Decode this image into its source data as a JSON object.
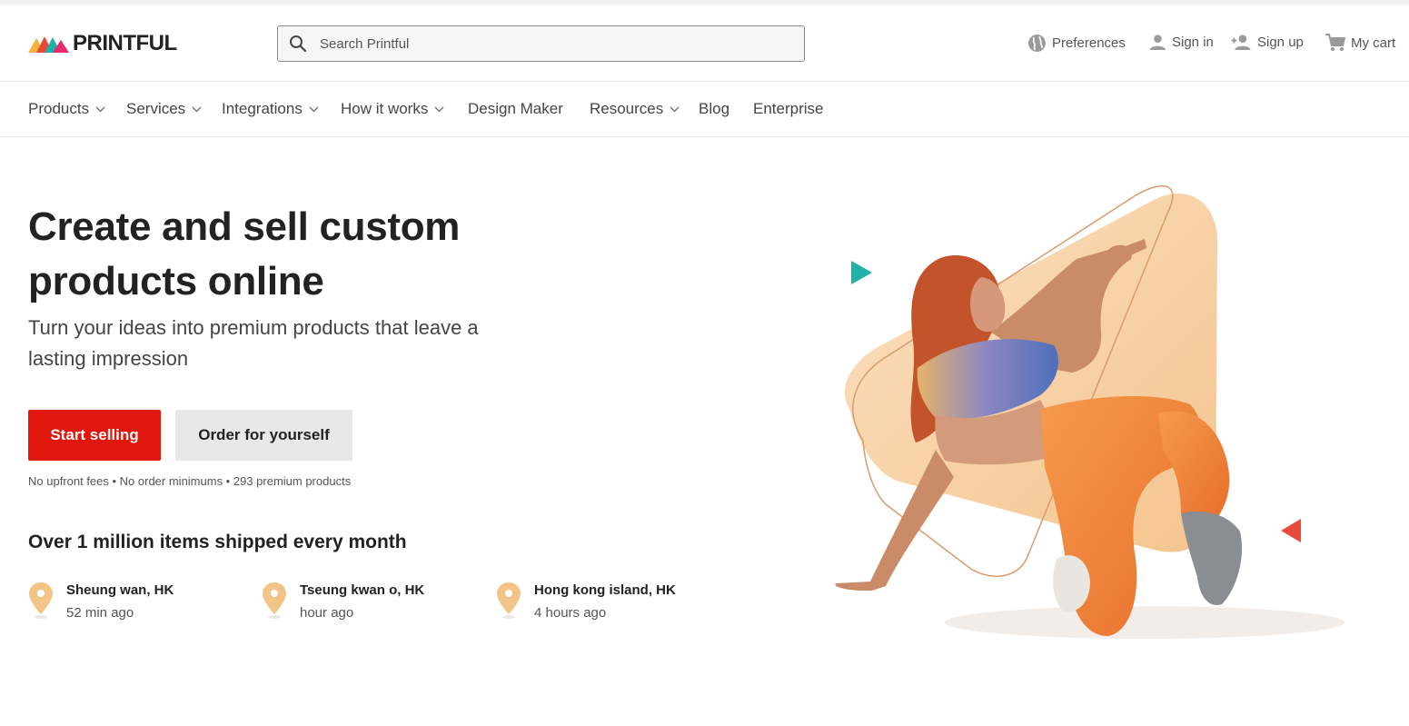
{
  "brand": {
    "name": "PRINTFUL",
    "colors": {
      "accent_red": "#e1170e",
      "teal": "#1fb1a6",
      "peach": "#f7cfa3",
      "orange": "#f08a3c"
    }
  },
  "search": {
    "placeholder": "Search Printful"
  },
  "utility": {
    "preferences": "Preferences",
    "sign_in": "Sign in",
    "sign_up": "Sign up",
    "cart": "My cart"
  },
  "nav": {
    "items": [
      {
        "label": "Products",
        "has_dropdown": true
      },
      {
        "label": "Services",
        "has_dropdown": true
      },
      {
        "label": "Integrations",
        "has_dropdown": true
      },
      {
        "label": "How it works",
        "has_dropdown": true
      },
      {
        "label": "Design Maker",
        "has_dropdown": false
      },
      {
        "label": "Resources",
        "has_dropdown": true
      },
      {
        "label": "Blog",
        "has_dropdown": false
      },
      {
        "label": "Enterprise",
        "has_dropdown": false
      }
    ]
  },
  "hero": {
    "title": "Create and sell custom products online",
    "subtitle": "Turn your ideas into premium products that leave a lasting impression",
    "primary_cta": "Start selling",
    "secondary_cta": "Order for yourself",
    "fine_print": "No upfront fees • No order minimums • 293 premium products"
  },
  "shipping": {
    "title": "Over 1 million items shipped every month",
    "locations": [
      {
        "place": "Sheung wan, HK",
        "time": "52 min ago"
      },
      {
        "place": "Tseung kwan o, HK",
        "time": "hour ago"
      },
      {
        "place": "Hong kong island, HK",
        "time": "4 hours ago"
      }
    ]
  }
}
